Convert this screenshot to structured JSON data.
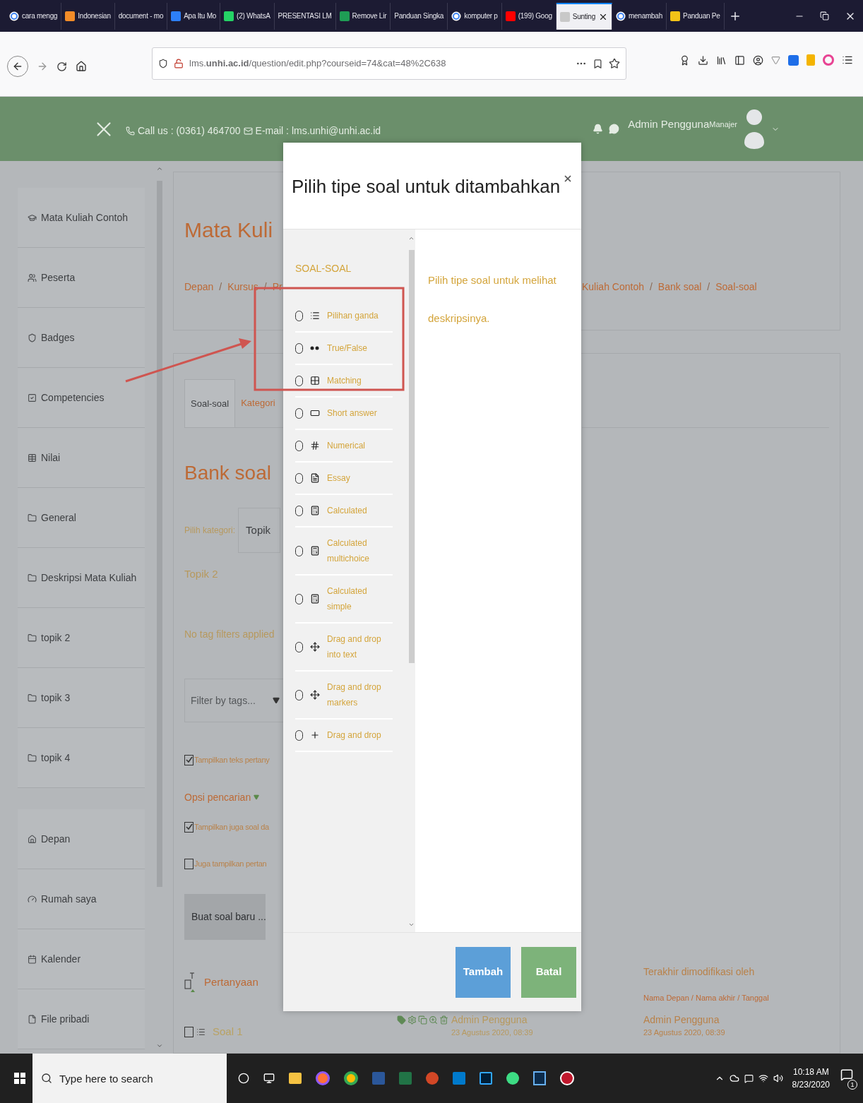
{
  "browser": {
    "tabs": [
      {
        "label": "cara mengg",
        "kind": "google",
        "selected": false
      },
      {
        "label": "Indonesian",
        "kind": "orange",
        "selected": false
      },
      {
        "label": "document - mo",
        "kind": "plain",
        "selected": false
      },
      {
        "label": "Apa Itu Mo",
        "kind": "blue",
        "selected": false
      },
      {
        "label": "(2) WhatsA",
        "kind": "whatsapp",
        "selected": false
      },
      {
        "label": "PRESENTASI LM",
        "kind": "plain",
        "selected": false
      },
      {
        "label": "Remove Lir",
        "kind": "green",
        "selected": false
      },
      {
        "label": "Panduan Singka",
        "kind": "plain",
        "selected": false
      },
      {
        "label": "komputer p",
        "kind": "google",
        "selected": false
      },
      {
        "label": "(199) Goog",
        "kind": "youtube",
        "selected": false
      },
      {
        "label": "Sunting",
        "kind": "page",
        "selected": true
      },
      {
        "label": "menambah",
        "kind": "google",
        "selected": false
      },
      {
        "label": "Panduan Pe",
        "kind": "yellow",
        "selected": false
      }
    ],
    "url": "lms.**unhi.ac.id**/question/edit.php?courseid=74&cat=48%2C638"
  },
  "header": {
    "phone": "Call us : (0361) 464700",
    "email": "E-mail : lms.unhi@unhi.ac.id",
    "user_name": "Admin Pengguna",
    "user_role": "Manajer"
  },
  "sidebar": {
    "groups": [
      [
        {
          "label": "Mata Kuliah Contoh",
          "kind": "cap"
        },
        {
          "label": "Peserta",
          "kind": "users"
        },
        {
          "label": "Badges",
          "kind": "shield"
        },
        {
          "label": "Competencies",
          "kind": "check"
        },
        {
          "label": "Nilai",
          "kind": "table"
        },
        {
          "label": "General",
          "kind": "folder"
        },
        {
          "label": "Deskripsi Mata Kuliah",
          "kind": "folder"
        },
        {
          "label": "topik 2",
          "kind": "folder"
        },
        {
          "label": "topik 3",
          "kind": "folder"
        },
        {
          "label": "topik 4",
          "kind": "folder"
        }
      ],
      [
        {
          "label": "Depan",
          "kind": "home"
        },
        {
          "label": "Rumah saya",
          "kind": "gauge"
        },
        {
          "label": "Kalender",
          "kind": "calendar"
        },
        {
          "label": "File pribadi",
          "kind": "file"
        }
      ]
    ]
  },
  "course": {
    "title": "Mata Kuli",
    "breadcrumb": {
      "separator": "/",
      "left": [
        "Depan",
        "Kursus",
        "Pr"
      ],
      "right": [
        "Kuliah Contoh",
        "Bank soal",
        "Soal-soal"
      ]
    }
  },
  "bank": {
    "tabs": [
      {
        "label": "Soal-soal",
        "selected": true
      },
      {
        "label": "Kategori",
        "selected": false
      }
    ],
    "heading": "Bank soal",
    "category_label": "Pilih kategori:",
    "category_value": "Topik",
    "category_name": "Topik 2",
    "tag_status": "No tag filters applied",
    "tag_filter": {
      "placeholder": "Filter by tags..."
    },
    "show_text": {
      "label": "Tampilkan teks pertany",
      "checked": true
    },
    "search_options": "Opsi pencarian",
    "options": [
      {
        "label": "Tampilkan juga soal da",
        "checked": true
      },
      {
        "label": "Juga tampilkan pertan",
        "checked": false
      }
    ],
    "create_button": "Buat soal baru ...",
    "table": {
      "question_column": "Pertanyaan",
      "modified_title": "Terakhir dimodifikasi oleh",
      "modified_sub": "Nama Depan / Nama akhir / Tanggal",
      "rows": [
        {
          "name": "Soal 1",
          "checked": false,
          "created_by": "Admin Pengguna",
          "created_on": "23 Agustus 2020, 08:39",
          "modified_by": "Admin Pengguna",
          "modified_on": "23 Agustus 2020, 08:39"
        }
      ]
    }
  },
  "modal": {
    "title": "Pilih tipe soal untuk ditambahkan",
    "section": "SOAL-SOAL",
    "types": [
      {
        "label": "Pilihan ganda",
        "kind": "multichoice",
        "selected": false
      },
      {
        "label": "True/False",
        "kind": "truefalse",
        "selected": false
      },
      {
        "label": "Matching",
        "kind": "match",
        "selected": false
      },
      {
        "label": "Short answer",
        "kind": "shortanswer",
        "selected": false
      },
      {
        "label": "Numerical",
        "kind": "numerical",
        "selected": false
      },
      {
        "label": "Essay",
        "kind": "essay",
        "selected": false
      },
      {
        "label": "Calculated",
        "kind": "calculated",
        "selected": false
      },
      {
        "label": "Calculated multichoice",
        "kind": "calculated",
        "selected": false
      },
      {
        "label": "Calculated simple",
        "kind": "calculated",
        "selected": false
      },
      {
        "label": "Drag and drop into text",
        "kind": "dragtext",
        "selected": false
      },
      {
        "label": "Drag and drop markers",
        "kind": "dragmarker",
        "selected": false
      },
      {
        "label": "Drag and drop",
        "kind": "dragimage",
        "selected": false
      }
    ],
    "description": "Pilih tipe soal untuk melihat deskripsinya.",
    "buttons": [
      {
        "label": "Tambah",
        "kind": "primary"
      },
      {
        "label": "Batal",
        "kind": "cancel"
      }
    ]
  },
  "taskbar": {
    "search_placeholder": "Type here to search",
    "time": "10:18 AM",
    "date": "8/23/2020",
    "notifications": "1"
  }
}
